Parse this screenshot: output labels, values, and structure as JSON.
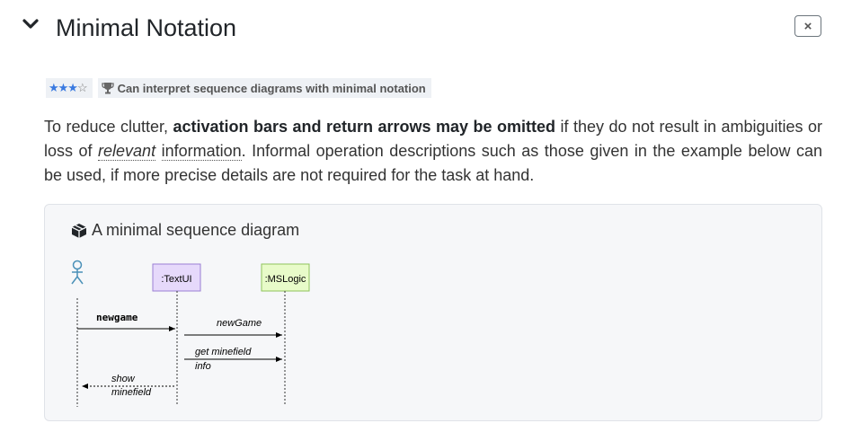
{
  "header": {
    "title": "Minimal Notation",
    "close_label": "×"
  },
  "badges": {
    "stars_full": "★★★",
    "stars_empty": "☆",
    "outcome": "Can interpret sequence diagrams with minimal notation"
  },
  "paragraph": {
    "part1": "To reduce clutter, ",
    "bold": "activation bars and return arrows may be omitted",
    "part2": " if they do not result in ambiguities or loss of ",
    "tip1": "relevant",
    "part3": " ",
    "tip2": "information",
    "part4": ". Informal operation descriptions such as those given in the example below can be used, if more precise details are not required for the task at hand."
  },
  "example": {
    "title": "A minimal sequence diagram",
    "participants": [
      ":TextUI",
      ":MSLogic"
    ],
    "messages": {
      "m1": "newgame",
      "m2": "newGame",
      "m3a": "get minefield",
      "m3b": "info",
      "m4a": "show",
      "m4b": "minefield"
    },
    "colors": {
      "textui_fill": "#e6d9fb",
      "textui_stroke": "#9b7fd4",
      "mslogic_fill": "#e8fbc9",
      "mslogic_stroke": "#8fc35a",
      "actor": "#4a90b8"
    }
  }
}
